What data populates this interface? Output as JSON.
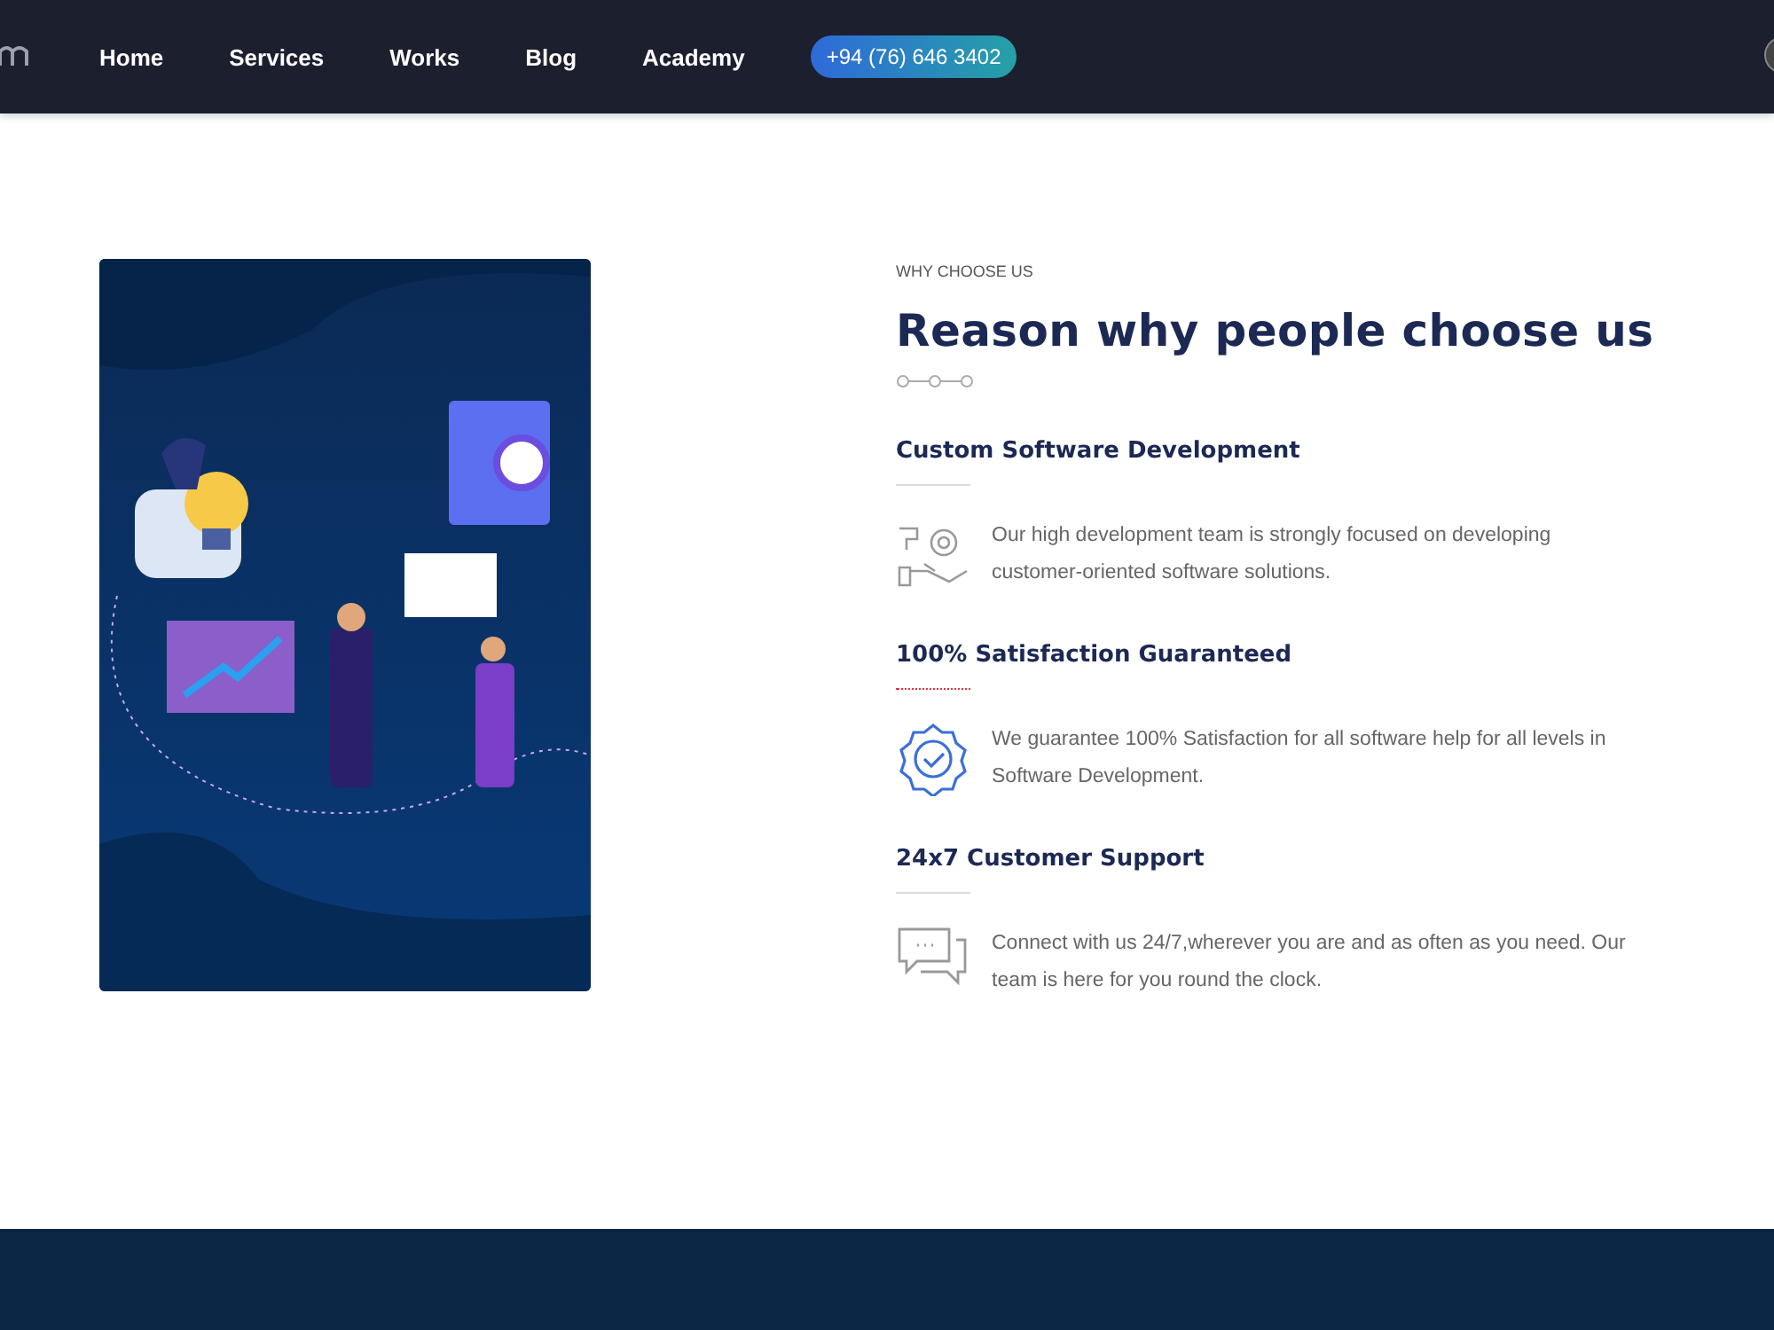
{
  "nav": {
    "items": [
      {
        "label": "Home"
      },
      {
        "label": "Services"
      },
      {
        "label": "Works"
      },
      {
        "label": "Blog"
      },
      {
        "label": "Academy"
      }
    ],
    "phone": "+94 (76) 646 3402"
  },
  "section": {
    "eyebrow": "WHY CHOOSE US",
    "title": "Reason why people choose us",
    "features": [
      {
        "title": "Custom Software Development",
        "active": false,
        "kind": "gear-hand",
        "text": "Our high development team is strongly focused on developing customer-oriented software solutions."
      },
      {
        "title": "100% Satisfaction Guaranteed",
        "active": true,
        "kind": "badge-check",
        "text": "We guarantee 100% Satisfaction for all software help for all levels in Software Development."
      },
      {
        "title": "24x7 Customer Support",
        "active": false,
        "kind": "chat",
        "text": "Connect with us 24/7,wherever you are and as often as you need. Our team is here for you round the clock."
      }
    ]
  }
}
